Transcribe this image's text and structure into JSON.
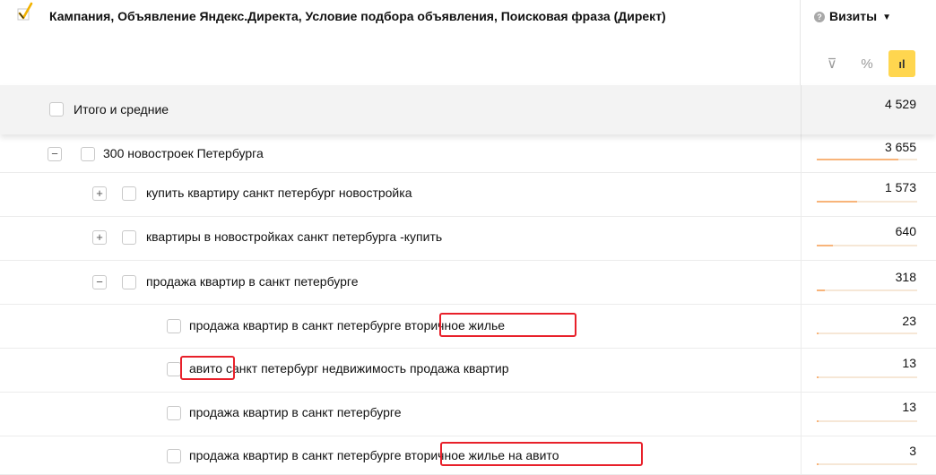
{
  "header": {
    "title": "Кампания, Объявление Яндекс.Директа, Условие подбора объявления, Поисковая фраза (Директ)",
    "metric_label": "Визиты",
    "help_icon": "?",
    "caret_icon": "▼",
    "tools": {
      "filter_icon": "⊽",
      "percent_icon": "%",
      "chart_icon": "ıl"
    }
  },
  "total": {
    "label": "Итого и средние",
    "value": "4 529"
  },
  "rows": [
    {
      "toggle": "−",
      "label": "300 новостроек Петербурга",
      "value": "3 655",
      "share": 0.81
    },
    {
      "toggle": "+",
      "label": "купить квартиру санкт петербург новостройка",
      "value": "1 573",
      "share": 0.4
    },
    {
      "toggle": "+",
      "label": "квартиры в новостройках санкт петербурга -купить",
      "value": "640",
      "share": 0.16
    },
    {
      "toggle": "−",
      "label": "продажа квартир в санкт петербурге",
      "value": "318",
      "share": 0.08
    },
    {
      "label": "продажа квартир в санкт петербурге вторичное жилье",
      "value": "23",
      "share": 0.006
    },
    {
      "label": "авито санкт петербург недвижимость продажа квартир",
      "value": "13",
      "share": 0.004
    },
    {
      "label": "продажа квартир в санкт петербурге",
      "value": "13",
      "share": 0.004
    },
    {
      "label": "продажа квартир в санкт петербурге вторичное жилье на авито",
      "value": "3",
      "share": 0.001
    }
  ],
  "colors": {
    "accent": "#ffd64f",
    "highlight": "#e8202a",
    "bar": "#f8b47a",
    "bar_track": "#f6e7d6"
  }
}
